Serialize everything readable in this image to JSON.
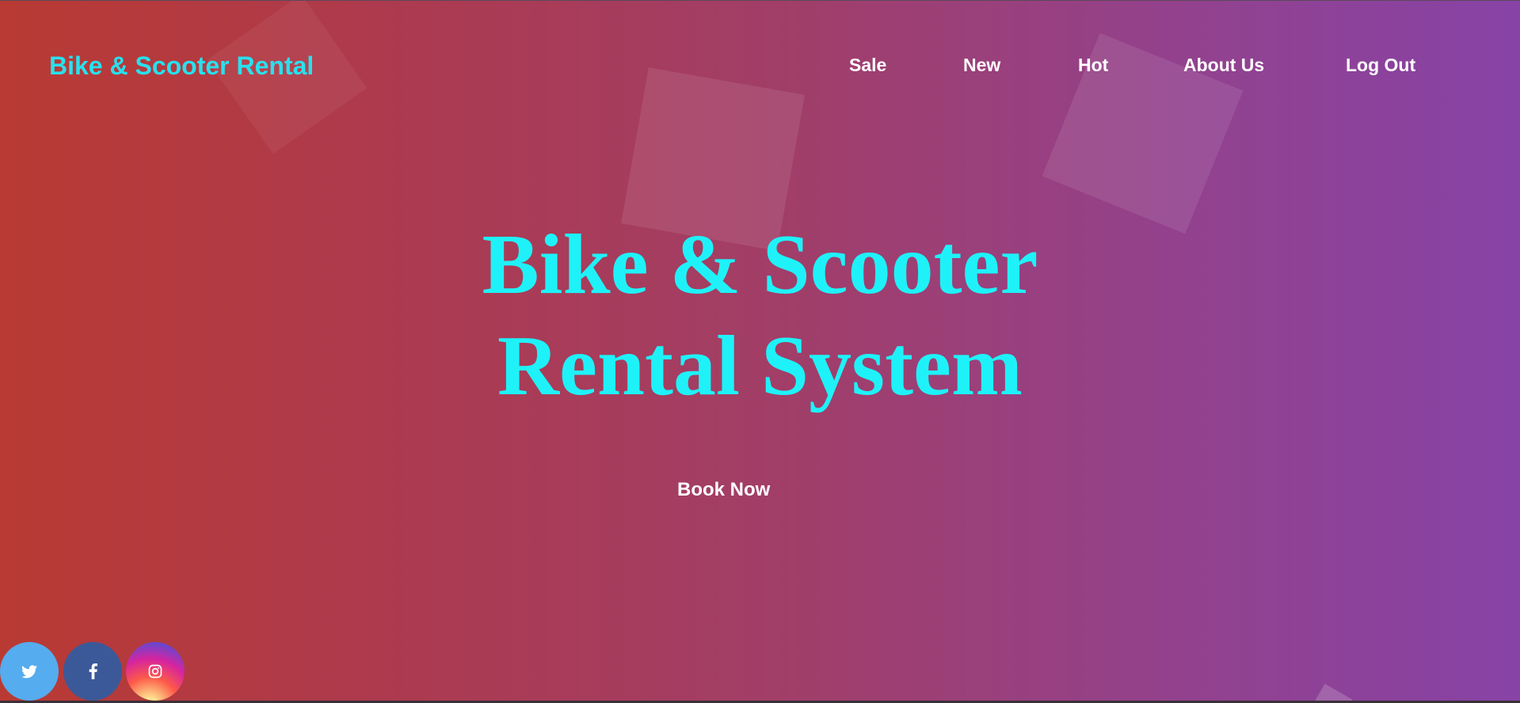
{
  "brand": {
    "title": "Bike & Scooter Rental",
    "color": "#27e1ee"
  },
  "nav": {
    "items": [
      {
        "label": "Sale"
      },
      {
        "label": "New"
      },
      {
        "label": "Hot"
      },
      {
        "label": "About Us"
      },
      {
        "label": "Log Out"
      }
    ]
  },
  "hero": {
    "line1": "Bike & Scooter",
    "line2": "Rental System",
    "color": "#1ef2f8"
  },
  "cta": {
    "label": "Book Now"
  },
  "social": [
    {
      "icon": "twitter-icon",
      "color": "#55acee"
    },
    {
      "icon": "facebook-icon",
      "color": "#3b5998"
    },
    {
      "icon": "instagram-icon",
      "color": "#d6249f"
    }
  ],
  "background": {
    "gradient_start": "#b93a33",
    "gradient_end": "#8743a6"
  }
}
